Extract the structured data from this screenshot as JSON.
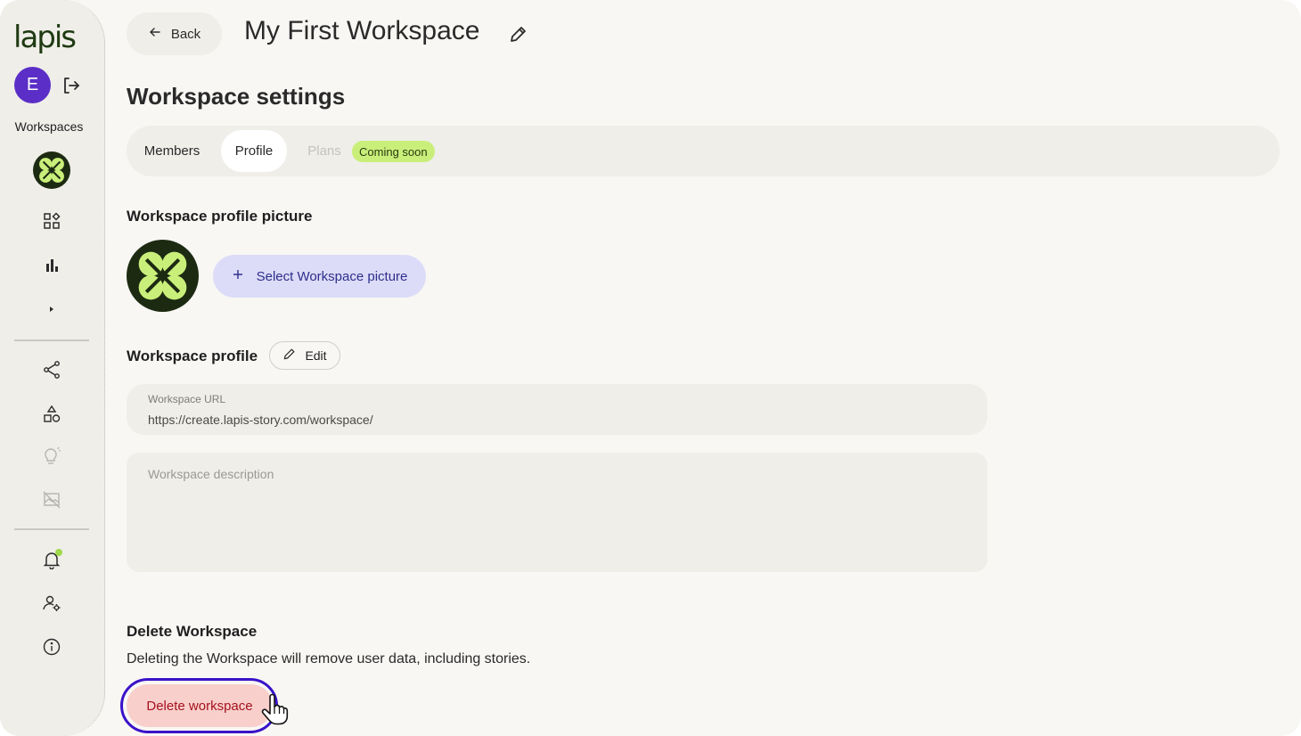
{
  "app": {
    "logo_text": "lapis"
  },
  "user": {
    "avatar_initial": "E",
    "avatar_color": "#5b2ec7"
  },
  "sidebar": {
    "workspaces_label": "Workspaces",
    "icons": [
      "workspace-logo-icon",
      "grid-icon",
      "bar-chart-icon",
      "caret-right-icon",
      "share-icon",
      "shapes-icon",
      "lightbulb-icon",
      "image-off-icon",
      "bell-icon",
      "user-settings-icon",
      "info-icon"
    ]
  },
  "header": {
    "back_label": "Back",
    "workspace_title": "My First Workspace"
  },
  "settings": {
    "title": "Workspace settings",
    "tabs": [
      {
        "label": "Members",
        "active": false
      },
      {
        "label": "Profile",
        "active": true
      },
      {
        "label": "Plans",
        "active": false,
        "disabled": true
      }
    ],
    "plans_badge": "Coming soon"
  },
  "profile_picture": {
    "heading": "Workspace profile picture",
    "select_label": "Select Workspace picture"
  },
  "profile": {
    "heading": "Workspace profile",
    "edit_label": "Edit",
    "url_label": "Workspace URL",
    "url_value": "https://create.lapis-story.com/workspace/",
    "description_placeholder": "Workspace description"
  },
  "delete": {
    "heading": "Delete Workspace",
    "description": "Deleting the Workspace will remove user data, including stories.",
    "button_label": "Delete workspace"
  },
  "colors": {
    "accent_purple": "#5b2ec7",
    "lime": "#c9ef7a",
    "danger_bg": "#f9cfcb",
    "danger_text": "#a3121e",
    "focus_ring": "#3a12c9"
  }
}
